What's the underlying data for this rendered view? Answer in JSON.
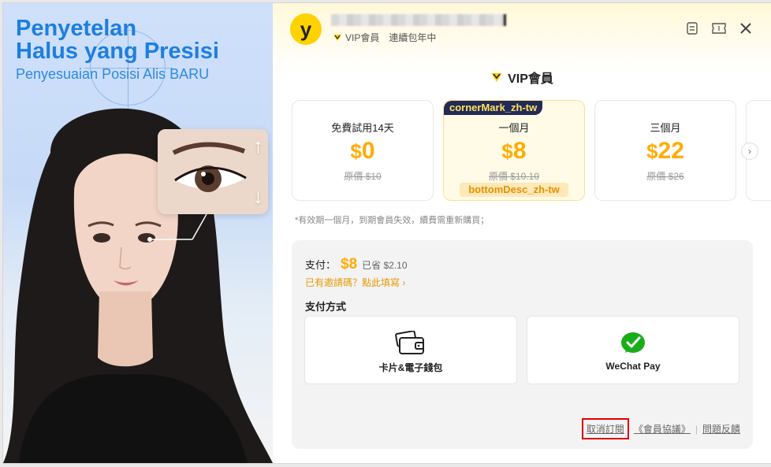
{
  "promo": {
    "title": "Penyetelan\nHalus yang Presisi",
    "subtitle": "Penyesuaian Posisi Alis BARU"
  },
  "header": {
    "avatar_letter": "y",
    "vip_label": "VIP會員",
    "vip_status": "連續包年中"
  },
  "heading": "VIP會員",
  "plans": [
    {
      "name": "免費試用14天",
      "currency": "$",
      "price": "0",
      "original": "原價 $10",
      "selected": false
    },
    {
      "name": "一個月",
      "currency": "$",
      "price": "8",
      "original": "原價 $10.10",
      "selected": true,
      "corner_mark": "cornerMark_zh-tw",
      "bottom_desc": "bottomDesc_zh-tw"
    },
    {
      "name": "三個月",
      "currency": "$",
      "price": "22",
      "original": "原價 $26",
      "selected": false
    }
  ],
  "note": "*有效期一個月，到期會員失效，續費需重新購買；",
  "payment": {
    "label": "支付：",
    "amount": "$8",
    "saved": "已省 $2.10",
    "invite": "已有邀請碼？點此填寫 ›",
    "method_title": "支付方式",
    "methods": [
      {
        "label": "卡片&電子錢包",
        "icon": "wallet-card-icon"
      },
      {
        "label": "WeChat Pay",
        "icon": "wechat-icon"
      }
    ]
  },
  "links": {
    "cancel": "取消訂閱",
    "agreement": "《會員協議》",
    "feedback": "問題反饋"
  },
  "colors": {
    "accent": "#ffac00",
    "brand_yellow": "#ffd200",
    "promo_blue": "#1d7fe0",
    "wechat_green": "#1aad19",
    "highlight_red": "#e00000"
  }
}
